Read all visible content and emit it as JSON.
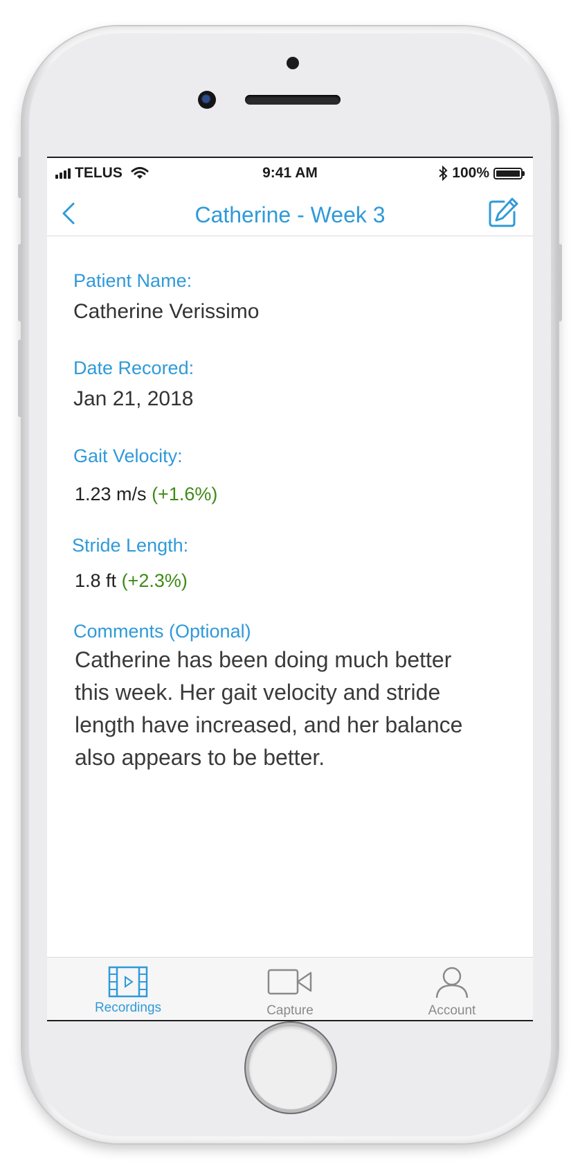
{
  "status_bar": {
    "carrier": "TELUS",
    "time": "9:41 AM",
    "battery": "100%",
    "signal_bars": 4,
    "icons": [
      "signal-icon",
      "wifi-icon",
      "bluetooth-icon",
      "battery-icon"
    ]
  },
  "nav": {
    "title": "Catherine - Week 3",
    "back_icon": "chevron-left-icon",
    "edit_icon": "edit-icon"
  },
  "fields": {
    "patient_name_label": "Patient Name:",
    "patient_name": "Catherine Verissimo",
    "date_label": "Date Recored:",
    "date": "Jan 21, 2018",
    "gait_label": "Gait Velocity:",
    "gait_value": "1.23 m/s",
    "gait_change": "(+1.6%)",
    "stride_label": "Stride Length:",
    "stride_value": "1.8 ft",
    "stride_change": "(+2.3%)",
    "comments_label": "Comments (Optional)",
    "comments": "Catherine has been doing much better this week. Her gait velocity and stride length have increased, and her balance also appears to be better."
  },
  "tabs": [
    {
      "label": "Recordings",
      "icon": "film-icon",
      "active": true
    },
    {
      "label": "Capture",
      "icon": "video-camera-icon",
      "active": false
    },
    {
      "label": "Account",
      "icon": "person-icon",
      "active": false
    }
  ],
  "colors": {
    "accent": "#2f9ad8",
    "positive": "#3f8a16",
    "text": "#333333",
    "inactive_tab": "#8a8a8a"
  }
}
